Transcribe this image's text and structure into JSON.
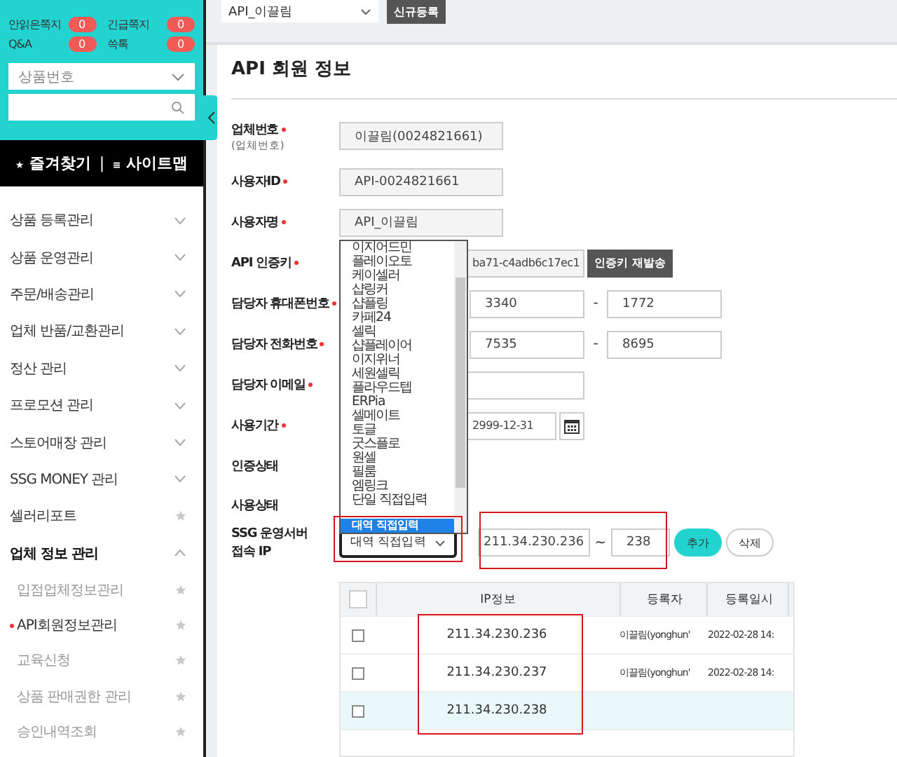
{
  "sidebar": {
    "counters": [
      {
        "label": "안읽은쪽지",
        "count": "0"
      },
      {
        "label": "긴급쪽지",
        "count": "0"
      },
      {
        "label": "Q&A",
        "count": "0"
      },
      {
        "label": "쓱톡",
        "count": "0"
      }
    ],
    "search_type": {
      "value": "상품번호"
    },
    "shortcuts": [
      {
        "icon": "★",
        "label": "즐겨찾기"
      },
      {
        "icon": "≡",
        "label": "사이트맵"
      }
    ],
    "shortcut_separator": "|",
    "menu": [
      {
        "label": "상품 등록관리",
        "kind": "group",
        "expanded": false
      },
      {
        "label": "상품 운영관리",
        "kind": "group",
        "expanded": false
      },
      {
        "label": "주문/배송관리",
        "kind": "group",
        "expanded": false
      },
      {
        "label": "업체 반품/교환관리",
        "kind": "group",
        "expanded": false
      },
      {
        "label": "정산 관리",
        "kind": "group",
        "expanded": false
      },
      {
        "label": "프로모션 관리",
        "kind": "group",
        "expanded": false
      },
      {
        "label": "스토어매장 관리",
        "kind": "group",
        "expanded": false
      },
      {
        "label": "SSG MONEY 관리",
        "kind": "group",
        "expanded": false
      },
      {
        "label": "셀러리포트",
        "kind": "link"
      },
      {
        "label": "업체 정보 관리",
        "kind": "group",
        "expanded": true,
        "children": [
          {
            "label": "입점업체정보관리",
            "selected": false
          },
          {
            "label": "API회원정보관리",
            "selected": true
          },
          {
            "label": "교육신청",
            "selected": false
          },
          {
            "label": "상품 판매권한 관리",
            "selected": false
          },
          {
            "label": "승인내역조회",
            "selected": false
          }
        ]
      }
    ]
  },
  "toolbar": {
    "account_select": "API_이끌림",
    "new_button": "신규등록"
  },
  "title": "API 회원 정보",
  "form": [
    {
      "kind": "text",
      "label": "업체번호",
      "sublabel": "(업체번호)",
      "required": true,
      "value": "이끌림(0024821661)"
    },
    {
      "kind": "text",
      "label": "사용자ID",
      "required": true,
      "value": "API-0024821661"
    },
    {
      "kind": "text",
      "label": "사용자명",
      "required": true,
      "value": "API_이끌림"
    },
    {
      "kind": "key",
      "label": "API 인증키",
      "required": true,
      "value": "ba71-c4adb6c17ec1",
      "button": "인증키 재발송"
    },
    {
      "kind": "phone",
      "label": "담당자 휴대폰번호",
      "required": true,
      "parts": [
        "3340",
        "1772"
      ],
      "separator": "-"
    },
    {
      "kind": "phone",
      "label": "담당자 전화번호",
      "required": true,
      "parts": [
        "7535",
        "8695"
      ],
      "separator": "-"
    },
    {
      "kind": "email",
      "label": "담당자 이메일",
      "required": true
    },
    {
      "kind": "date",
      "label": "사용기간",
      "required": true,
      "value": "2999-12-31"
    },
    {
      "kind": "status",
      "label": "인증상태",
      "required": false
    },
    {
      "kind": "status",
      "label": "사용상태",
      "required": false
    },
    {
      "kind": "ip",
      "label": "SSG 운영서버 접속 IP",
      "required": false,
      "mode": "대역 직접입력",
      "from": "211.34.230.236",
      "to": "238",
      "separator": "~",
      "add": "추가",
      "delete": "삭제"
    }
  ],
  "dropdown": {
    "options": [
      {
        "label": "이지어드민",
        "selected": false
      },
      {
        "label": "플레이오토",
        "selected": false
      },
      {
        "label": "케이셀러",
        "selected": false
      },
      {
        "label": "샵링커",
        "selected": false
      },
      {
        "label": "샵플링",
        "selected": false
      },
      {
        "label": "카페24",
        "selected": false
      },
      {
        "label": "셀릭",
        "selected": false
      },
      {
        "label": "샵플레이어",
        "selected": false
      },
      {
        "label": "이지위너",
        "selected": false
      },
      {
        "label": "세원셀릭",
        "selected": false
      },
      {
        "label": "플라우드텝",
        "selected": false
      },
      {
        "label": "ERPia",
        "selected": false
      },
      {
        "label": "셀메이트",
        "selected": false
      },
      {
        "label": "토글",
        "selected": false
      },
      {
        "label": "굿스플로",
        "selected": false
      },
      {
        "label": "원셀",
        "selected": false
      },
      {
        "label": "필룸",
        "selected": false
      },
      {
        "label": "엠링크",
        "selected": false
      },
      {
        "label": "단일 직접입력",
        "selected": false
      },
      {
        "label": "대역 직접입력",
        "selected": true
      }
    ]
  },
  "table": {
    "all_checked": false,
    "columns": [
      "IP정보",
      "등록자",
      "등록일시"
    ],
    "rows": [
      {
        "checked": false,
        "selected": false,
        "ip": "211.34.230.236",
        "registrant": "이끌림(yonghun'",
        "date": "2022-02-28 14:"
      },
      {
        "checked": false,
        "selected": false,
        "ip": "211.34.230.237",
        "registrant": "이끌림(yonghun'",
        "date": "2022-02-28 14:"
      },
      {
        "checked": false,
        "selected": true,
        "ip": "211.34.230.238"
      }
    ]
  }
}
